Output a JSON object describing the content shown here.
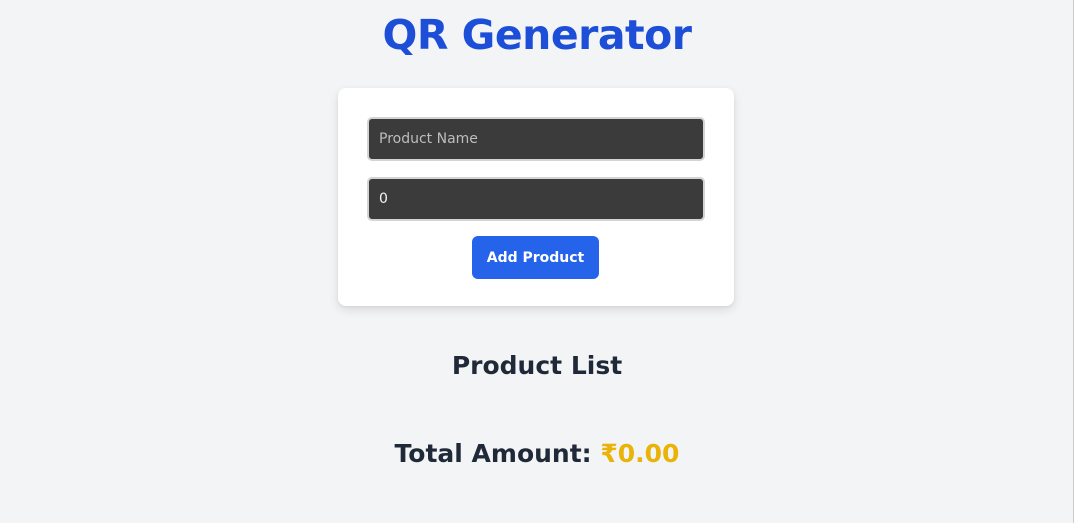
{
  "header": {
    "title": "QR Generator"
  },
  "form": {
    "product_name_placeholder": "Product Name",
    "product_name_value": "",
    "price_value": "0",
    "add_button_label": "Add Product"
  },
  "product_list": {
    "heading": "Product List",
    "items": []
  },
  "summary": {
    "total_label": "Total Amount: ",
    "total_value": "₹0.00"
  },
  "colors": {
    "title": "#1d4ed8",
    "button": "#2563eb",
    "total_value": "#eab308",
    "input_background": "#3b3b3b",
    "page_background": "#f3f4f6"
  }
}
